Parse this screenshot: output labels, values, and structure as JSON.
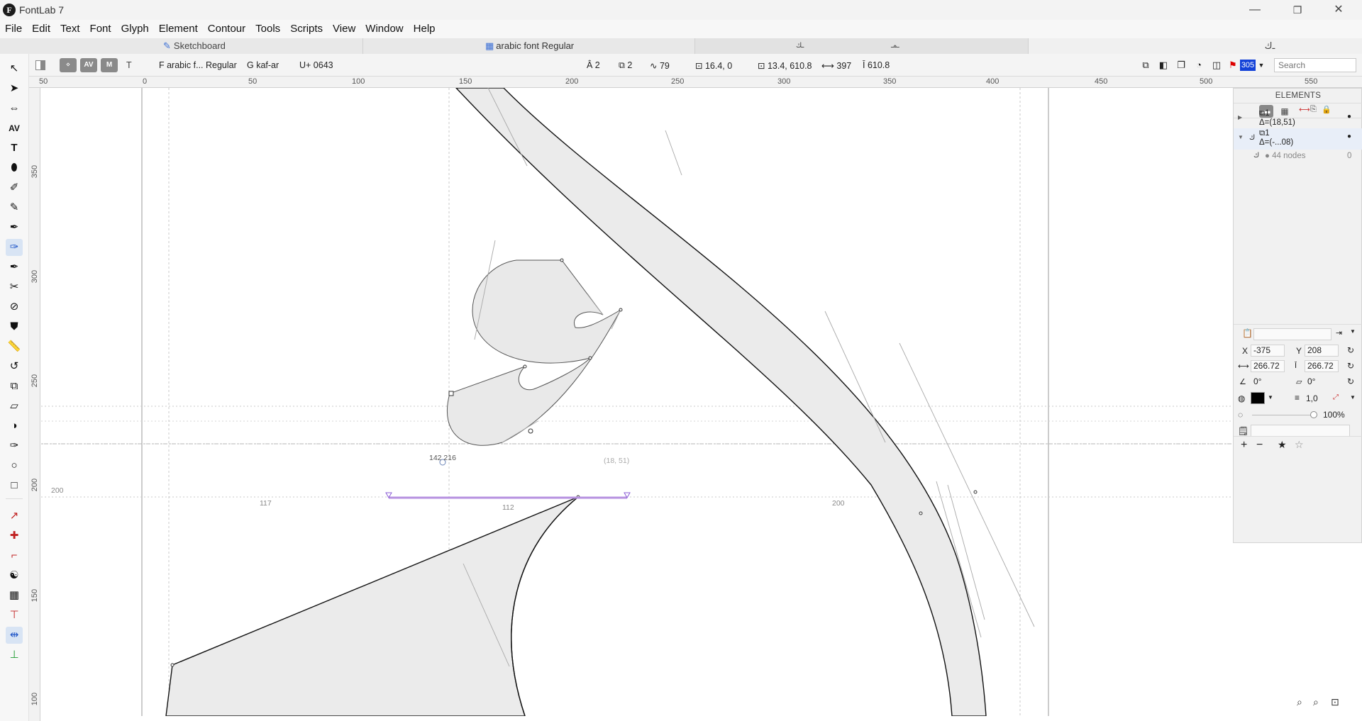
{
  "app": {
    "title": "FontLab 7",
    "logo_letter": "F"
  },
  "window_controls": {
    "minimize": "—",
    "maximize": "❐",
    "close": "✕"
  },
  "menu": [
    "File",
    "Edit",
    "Text",
    "Font",
    "Glyph",
    "Element",
    "Contour",
    "Tools",
    "Scripts",
    "View",
    "Window",
    "Help"
  ],
  "tabs": {
    "sketchboard": "Sketchboard",
    "font_window": "arabic font Regular",
    "glyph_tab_a": "ـك",
    "glyph_tab_b": "ـمـ",
    "glyph_tab_c": "ـﻙ"
  },
  "toolbar": {
    "font_name": "F arabic f... Regular",
    "glyph_name": "G kaf-ar",
    "unicode": "U+ 0643",
    "contours": "Â 2",
    "components": "⧉ 2",
    "nodes": "∿ 79",
    "point": "⊡ 16.4, 0",
    "bbox_origin": "⊡ 13.4, 610.8",
    "width": "⟷ 397",
    "height": "Ī 610.8",
    "mark_count": "305",
    "search_placeholder": "Search",
    "btn_a": "⋄",
    "btn_av": "AV",
    "btn_m": "M",
    "btn_t": "T"
  },
  "ruler": {
    "h_labels": [
      "50",
      "0",
      "50",
      "100",
      "150",
      "200",
      "250",
      "300",
      "350",
      "400",
      "450",
      "500",
      "550"
    ],
    "v_labels": [
      "350",
      "300",
      "250",
      "200",
      "150",
      "100"
    ]
  },
  "canvas": {
    "metric_200": "200",
    "sb_left": "117",
    "sb_mid": "112",
    "sb_right": "200",
    "coords_readout": "142  216",
    "delta_readout": "(18, 51)"
  },
  "elements_panel": {
    "title": "ELEMENTS",
    "row1_label": "⧉1",
    "row1_delta": "Δ=(18,51)",
    "row2_label": "⧉1",
    "row2_delta": "Δ=(-...08)",
    "row3_nodes": "● 44 nodes",
    "row3_count": "0"
  },
  "properties": {
    "x_label": "X",
    "x_value": "-375",
    "y_label": "Y",
    "y_value": "208",
    "w_value": "266.72",
    "h_value": "266.72",
    "rotate_value": "0°",
    "slant_value": "0°",
    "stroke_value": "1,0",
    "opacity_value": "100%",
    "fill_color": "#000000"
  },
  "zoom": {
    "zoom_out": "🔍",
    "zoom_in": "🔍",
    "fit": "⊡"
  }
}
